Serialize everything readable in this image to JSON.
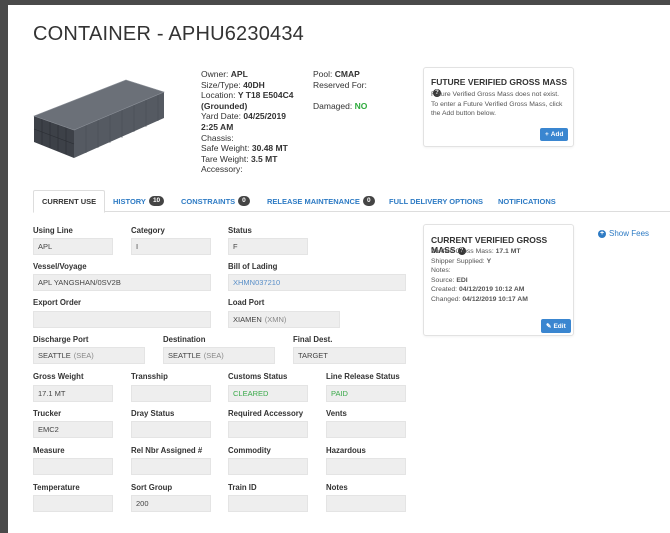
{
  "page": {
    "title": "CONTAINER - APHU6230434"
  },
  "details": {
    "owner_label": "Owner:",
    "owner_value": "APL",
    "size_label": "Size/Type:",
    "size_value": "40DH",
    "location_label": "Location:",
    "location_value": "Y T18 E504C4",
    "location_state": "(Grounded)",
    "yard_date_label": "Yard Date:",
    "yard_date_value": "04/25/2019",
    "yard_time": "2:25 AM",
    "chassis_label": "Chassis:",
    "safe_weight_label": "Safe Weight:",
    "safe_weight_value": "30.48 MT",
    "tare_weight_label": "Tare Weight:",
    "tare_weight_value": "3.5 MT",
    "accessory_label": "Accessory:",
    "pool_label": "Pool:",
    "pool_value": "CMAP",
    "reserved_label": "Reserved For:",
    "damaged_label": "Damaged:",
    "damaged_value": "NO"
  },
  "future_vgm": {
    "title": "FUTURE VERIFIED GROSS MASS",
    "line1": "Future Verified Gross Mass does not exist.",
    "line2": "To enter a Future Verified Gross Mass, click",
    "line3": "the Add button below.",
    "add_label": "Add"
  },
  "tabs": [
    {
      "label": "CURRENT USE"
    },
    {
      "label": "HISTORY",
      "count": "10"
    },
    {
      "label": "CONSTRAINTS",
      "count": "0"
    },
    {
      "label": "RELEASE MAINTENANCE",
      "count": "0"
    },
    {
      "label": "FULL DELIVERY OPTIONS"
    },
    {
      "label": "NOTIFICATIONS"
    }
  ],
  "fields": {
    "using_line": {
      "label": "Using Line",
      "value": "APL"
    },
    "category": {
      "label": "Category",
      "value": "I"
    },
    "status": {
      "label": "Status",
      "value": "F"
    },
    "vessel": {
      "label": "Vessel/Voyage",
      "value": "APL YANGSHAN/0SV2B"
    },
    "bill": {
      "label": "Bill of Lading",
      "value": "XHMN037210"
    },
    "export_order": {
      "label": "Export Order",
      "value": ""
    },
    "load_port": {
      "label": "Load Port",
      "value": "XIAMEN",
      "suffix": "(XMN)"
    },
    "discharge_port": {
      "label": "Discharge Port",
      "value": "SEATTLE",
      "suffix": "(SEA)"
    },
    "destination": {
      "label": "Destination",
      "value": "SEATTLE",
      "suffix": "(SEA)"
    },
    "final_dest": {
      "label": "Final Dest.",
      "value": "TARGET"
    },
    "gross_weight": {
      "label": "Gross Weight",
      "value": "17.1 MT"
    },
    "transship": {
      "label": "Transship",
      "value": ""
    },
    "customs_status": {
      "label": "Customs Status",
      "value": "CLEARED"
    },
    "line_release": {
      "label": "Line Release Status",
      "value": "PAID"
    },
    "trucker": {
      "label": "Trucker",
      "value": "EMC2"
    },
    "dray_status": {
      "label": "Dray Status",
      "value": ""
    },
    "required_accessory": {
      "label": "Required Accessory",
      "value": ""
    },
    "vents": {
      "label": "Vents",
      "value": ""
    },
    "measure": {
      "label": "Measure",
      "value": ""
    },
    "rel_nbr": {
      "label": "Rel Nbr Assigned #",
      "value": ""
    },
    "commodity": {
      "label": "Commodity",
      "value": ""
    },
    "hazardous": {
      "label": "Hazardous",
      "value": ""
    },
    "temperature": {
      "label": "Temperature",
      "value": ""
    },
    "sort_group": {
      "label": "Sort Group",
      "value": "200"
    },
    "train_id": {
      "label": "Train ID",
      "value": ""
    },
    "notes": {
      "label": "Notes",
      "value": ""
    }
  },
  "current_vgm": {
    "title": "CURRENT VERIFIED GROSS MASS",
    "vgm_label": "Verified Gross Mass:",
    "vgm_value": "17.1 MT",
    "shipper_label": "Shipper Supplied:",
    "shipper_value": "Y",
    "notes_label": "Notes:",
    "source_label": "Source:",
    "source_value": "EDI",
    "created_label": "Created:",
    "created_value": "04/12/2019 10:12 AM",
    "changed_label": "Changed:",
    "changed_value": "04/12/2019 10:17 AM",
    "edit_label": "Edit"
  },
  "show_fees": {
    "label": "Show Fees"
  },
  "colors": {
    "accent": "#2e7bc4",
    "green": "#2eaa3c",
    "button": "#3a86d0"
  }
}
